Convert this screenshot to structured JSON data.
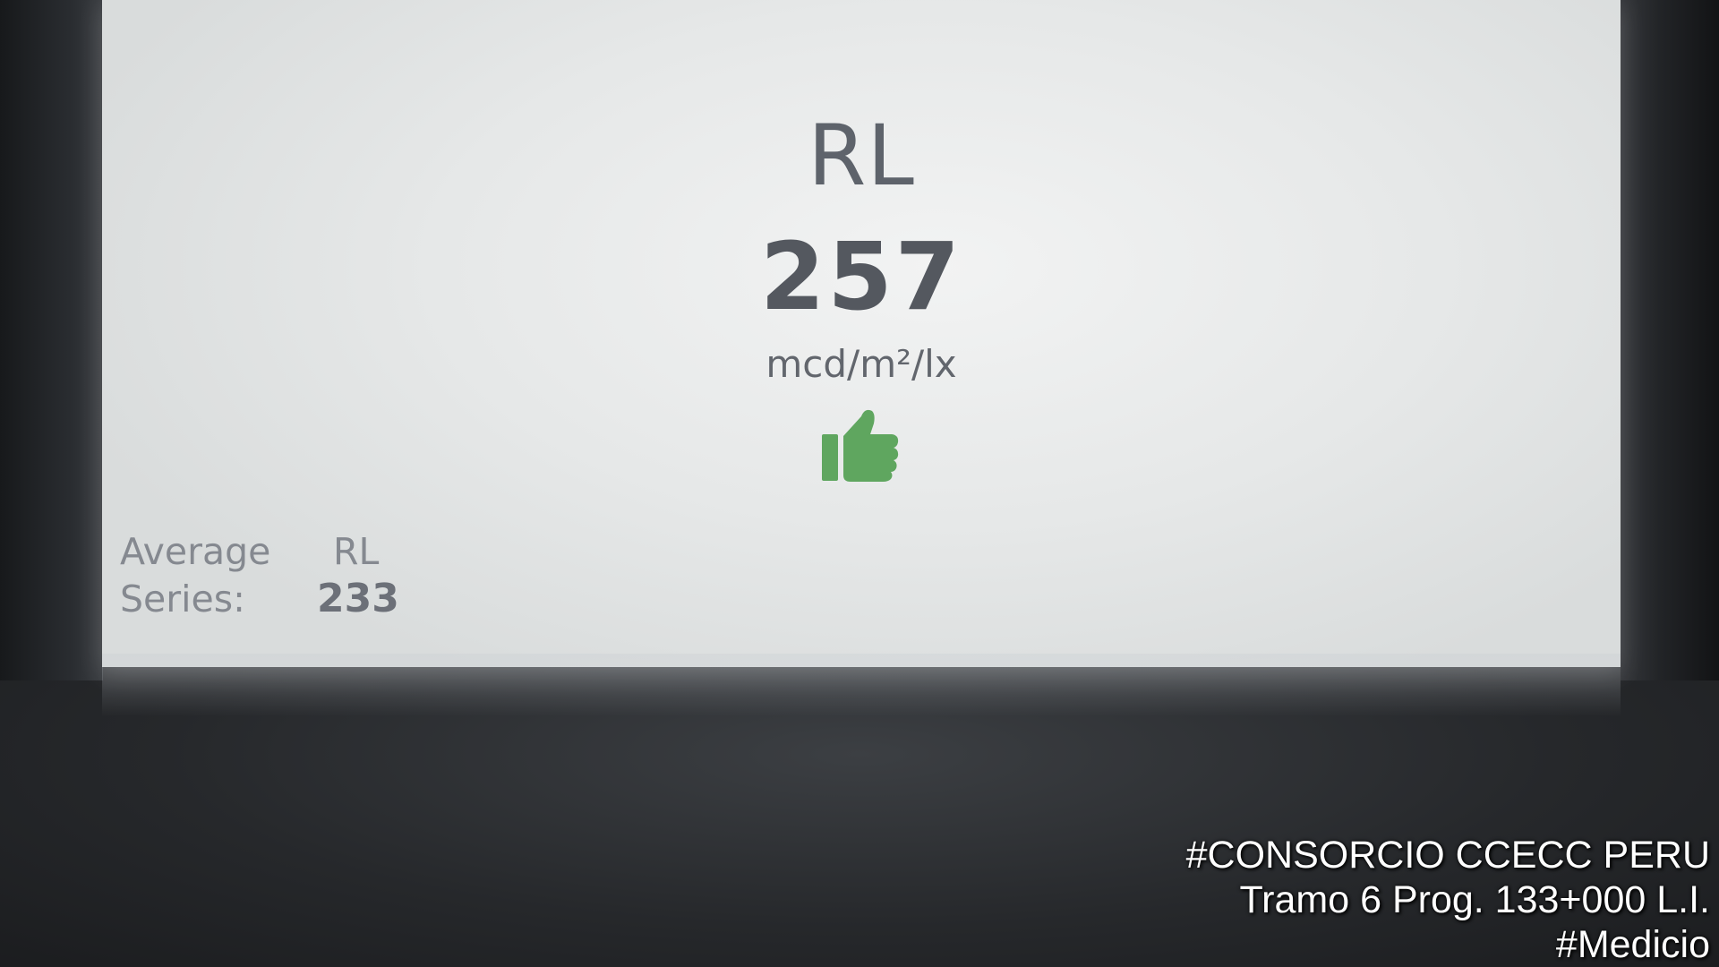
{
  "display": {
    "parameter": "RL",
    "value": "257",
    "unit": "mcd/m²/lx",
    "status_icon": "thumbs-up-icon",
    "status_color": "#5fa65f",
    "average": {
      "label_line1": "Average",
      "label_line2": "Series:",
      "parameter": "RL",
      "value": "233"
    }
  },
  "watermark": {
    "line1": "#CONSORCIO CCECC PERU",
    "line2": "Tramo 6 Prog. 133+000 L.I.",
    "line3": "#Medicio"
  }
}
